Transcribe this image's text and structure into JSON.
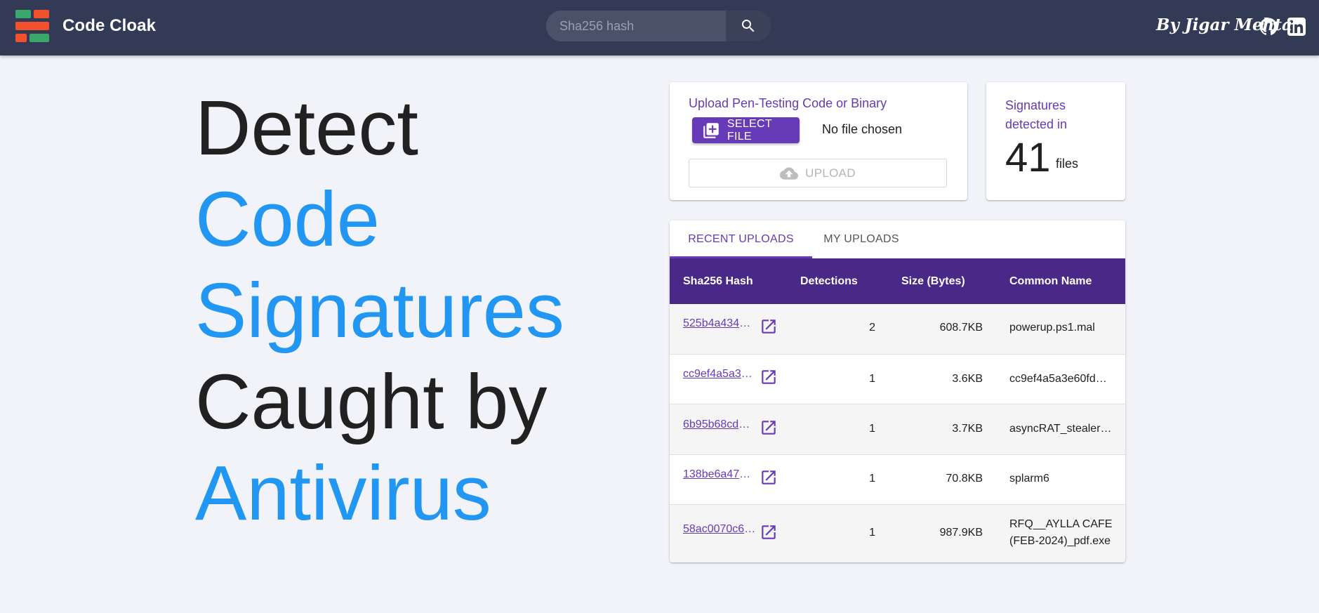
{
  "navbar": {
    "brand": "Code Cloak",
    "search_placeholder": "Sha256 hash",
    "author": "By Jigar Mehta"
  },
  "hero": {
    "line1": "Detect",
    "line2": "Code",
    "line3": "Signatures",
    "line4": "Caught by",
    "line5": "Antivirus"
  },
  "upload": {
    "title": "Upload Pen-Testing Code or Binary",
    "select_label": "SELECT FILE",
    "file_status": "No file chosen",
    "upload_label": "UPLOAD"
  },
  "stats": {
    "label": "Signatures detected in",
    "count": "41",
    "unit": "files"
  },
  "tabs": {
    "recent": "RECENT UPLOADS",
    "mine": "MY UPLOADS"
  },
  "table": {
    "headers": {
      "hash": "Sha256 Hash",
      "detections": "Detections",
      "size": "Size (Bytes)",
      "name": "Common Name"
    },
    "rows": [
      {
        "hash": "525b4a434c…",
        "detections": "2",
        "size": "608.7KB",
        "name": "powerup.ps1.mal"
      },
      {
        "hash": "cc9ef4a5a3e…",
        "detections": "1",
        "size": "3.6KB",
        "name": "cc9ef4a5a3e60fd…"
      },
      {
        "hash": "6b95b68cd0…",
        "detections": "1",
        "size": "3.7KB",
        "name": "asyncRAT_stealer…"
      },
      {
        "hash": "138be6a47a…",
        "detections": "1",
        "size": "70.8KB",
        "name": "splarm6"
      },
      {
        "hash": "58ac0070c6f…",
        "detections": "1",
        "size": "987.9KB",
        "name": "RFQ__AYLLA CAFE (FEB-2024)_pdf.exe"
      }
    ]
  },
  "colors": {
    "navbar": "#323a55",
    "accent_purple": "#673ab7",
    "table_header": "#4a2888",
    "hero_blue": "#2196f3",
    "logo_green": "#3aa76d",
    "logo_red": "#f1512e"
  },
  "icons": {
    "logo": "brick-logo-icon",
    "search": "search-icon",
    "github": "github-icon",
    "linkedin": "linkedin-icon",
    "select_file": "add-box-icon",
    "upload": "cloud-upload-icon",
    "open_link": "open-in-new-icon"
  }
}
